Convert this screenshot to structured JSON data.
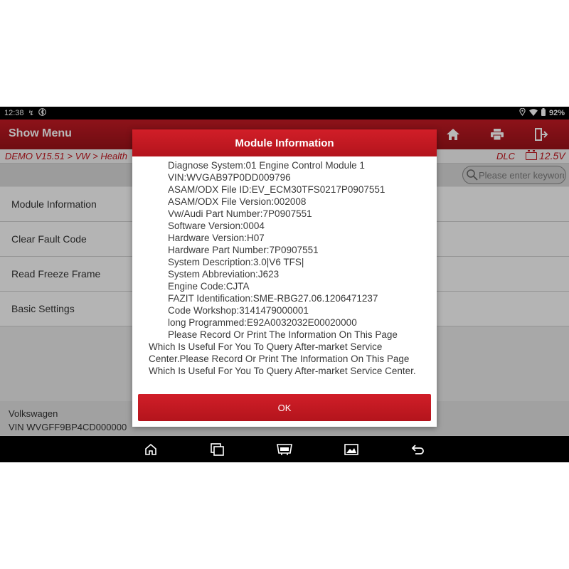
{
  "status_bar": {
    "time": "12:38",
    "battery": "92%"
  },
  "header": {
    "title": "Show Menu",
    "icons": [
      "home-icon",
      "print-icon",
      "exit-icon"
    ]
  },
  "breadcrumb": {
    "path": "DEMO V15.51 > VW > Health",
    "dlc": "DLC",
    "voltage": "12.5V"
  },
  "search": {
    "placeholder": "Please enter keyword"
  },
  "menu": {
    "items": [
      {
        "label": "Module Information"
      },
      {
        "label": "Clear Fault Code"
      },
      {
        "label": "Read Freeze Frame"
      },
      {
        "label": "Basic Settings"
      }
    ]
  },
  "vehicle": {
    "make": "Volkswagen",
    "vin": "VIN WVGFF9BP4CD000000"
  },
  "modal": {
    "title": "Module Information",
    "lines": [
      "Diagnose System:01 Engine Control Module 1",
      "VIN:WVGAB97P0DD009796",
      "ASAM/ODX File ID:EV_ECM30TFS0217P0907551",
      "ASAM/ODX File Version:002008",
      "Vw/Audi Part Number:7P0907551",
      "Software Version:0004",
      "Hardware Version:H07",
      "Hardware Part Number:7P0907551",
      "System Description:3.0|V6 TFS|",
      "System Abbreviation:J623",
      "Engine Code:CJTA",
      "FAZIT Identification:SME-RBG27.06.1206471237",
      "Code Workshop:3141479000001",
      "long Programmed:E92A0032032E00020000"
    ],
    "note": "Please Record Or Print The Information On This Page Which Is Useful For You To Query After-market Service Center.Please Record Or Print The Information On This Page Which Is Useful For You To Query After-market Service Center.",
    "ok_label": "OK"
  },
  "navbar": {
    "icons": [
      "home-icon",
      "recent-apps-icon",
      "vci-icon",
      "gallery-icon",
      "back-icon"
    ]
  },
  "colors": {
    "brand_red": "#c41a24",
    "crumb_red": "#c0141c"
  }
}
